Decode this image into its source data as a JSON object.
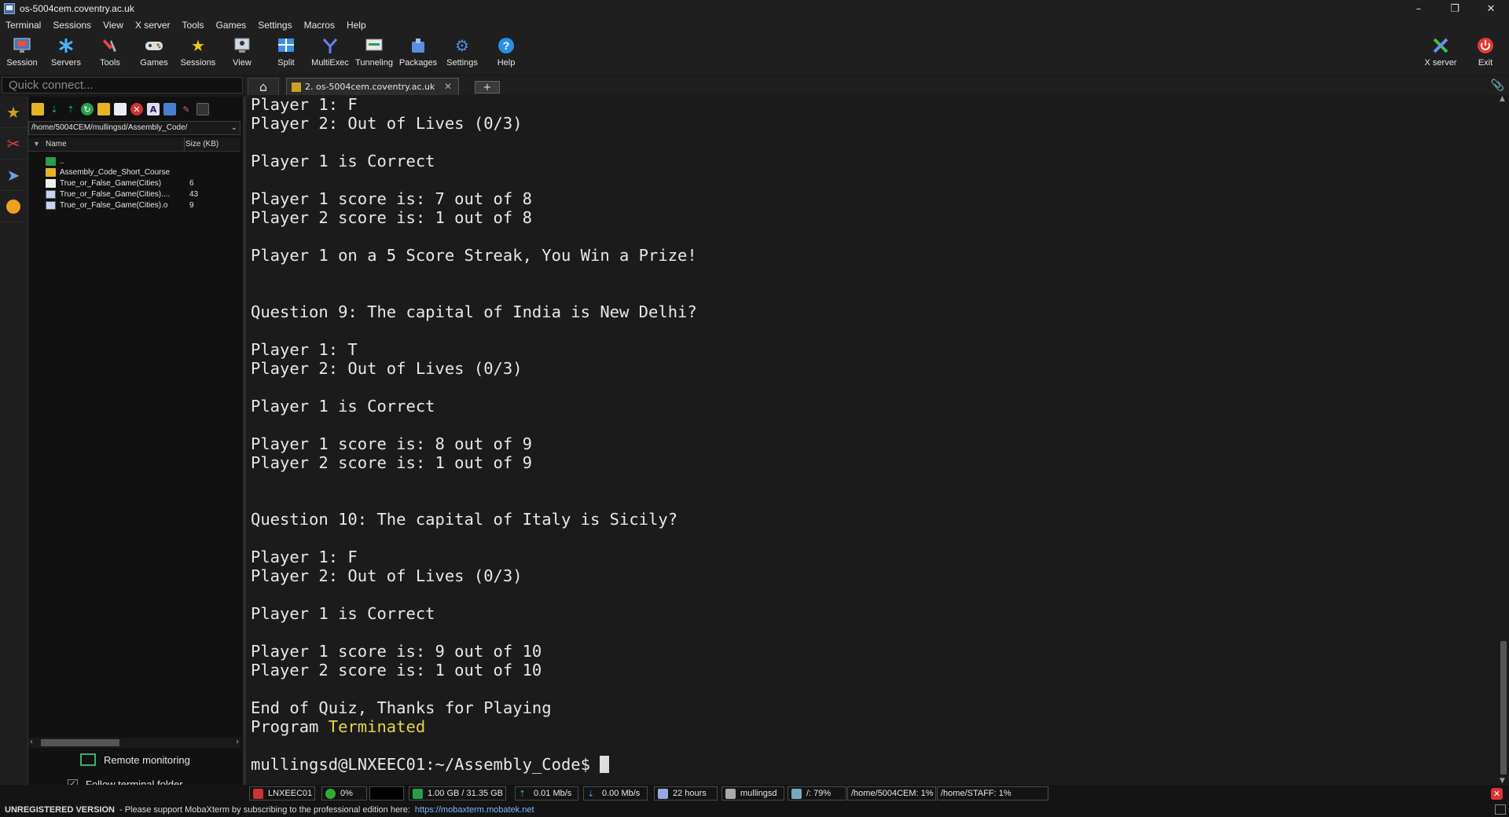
{
  "window": {
    "title": "os-5004cem.coventry.ac.uk",
    "minimize": "–",
    "maximize": "❐",
    "close": "✕"
  },
  "menu": [
    "Terminal",
    "Sessions",
    "View",
    "X server",
    "Tools",
    "Games",
    "Settings",
    "Macros",
    "Help"
  ],
  "toolbar": {
    "session": "Session",
    "servers": "Servers",
    "tools": "Tools",
    "games": "Games",
    "sessions": "Sessions",
    "view": "View",
    "split": "Split",
    "multiexec": "MultiExec",
    "tunneling": "Tunneling",
    "packages": "Packages",
    "settings": "Settings",
    "help": "Help",
    "xserver": "X server",
    "exit": "Exit"
  },
  "quickconnect": {
    "placeholder": "Quick connect..."
  },
  "tabs": {
    "session_label": "2. os-5004cem.coventry.ac.uk",
    "new_tab": "+"
  },
  "sftp": {
    "path": "/home/5004CEM/mullingsd/Assembly_Code/",
    "columns": {
      "name": "Name",
      "size": "Size (KB)"
    },
    "files": [
      {
        "name": "..",
        "size": "",
        "type": "updir"
      },
      {
        "name": "Assembly_Code_Short_Course",
        "size": "",
        "type": "folder"
      },
      {
        "name": "True_or_False_Game(Cities)",
        "size": "6",
        "type": "doc"
      },
      {
        "name": "True_or_False_Game(Cities)....",
        "size": "43",
        "type": "exec"
      },
      {
        "name": "True_or_False_Game(Cities).o",
        "size": "9",
        "type": "exec"
      }
    ],
    "remote_monitoring": "Remote monitoring",
    "follow_folder": "Follow terminal folder",
    "follow_checked": "✓"
  },
  "terminal": {
    "lines": [
      "Player 1: F",
      "Player 2: Out of Lives (0/3)",
      "",
      "Player 1 is Correct",
      "",
      "Player 1 score is: 7 out of 8",
      "Player 2 score is: 1 out of 8",
      "",
      "Player 1 on a 5 Score Streak, You Win a Prize!",
      "",
      "",
      "Question 9: The capital of India is New Delhi?",
      "",
      "Player 1: T",
      "Player 2: Out of Lives (0/3)",
      "",
      "Player 1 is Correct",
      "",
      "Player 1 score is: 8 out of 9",
      "Player 2 score is: 1 out of 9",
      "",
      "",
      "Question 10: The capital of Italy is Sicily?",
      "",
      "Player 1: F",
      "Player 2: Out of Lives (0/3)",
      "",
      "Player 1 is Correct",
      "",
      "Player 1 score is: 9 out of 10",
      "Player 2 score is: 1 out of 10",
      "",
      "End of Quiz, Thanks for Playing"
    ],
    "terminated_prefix": "Program ",
    "terminated_word": "Terminated",
    "blank_after": "",
    "prompt": "mullingsd@LNXEEC01:~/Assembly_Code$ "
  },
  "status": {
    "host": "LNXEEC01",
    "cpu": "0%",
    "memory": "1.00 GB / 31.35 GB",
    "upload": "0.01 Mb/s",
    "download": "0.00 Mb/s",
    "uptime": "22 hours",
    "user": "mullingsd",
    "disk_root": "/: 79%",
    "disk_5004cem": "/home/5004CEM: 1%",
    "disk_staff": "/home/STAFF: 1%"
  },
  "banner": {
    "version": "UNREGISTERED VERSION",
    "message": "-  Please support MobaXterm by subscribing to the professional edition here:",
    "link": "https://mobaxterm.mobatek.net"
  },
  "colors": {
    "accent": "#e8d44d",
    "background": "#1b1b1b",
    "link": "#7fb6ff"
  }
}
